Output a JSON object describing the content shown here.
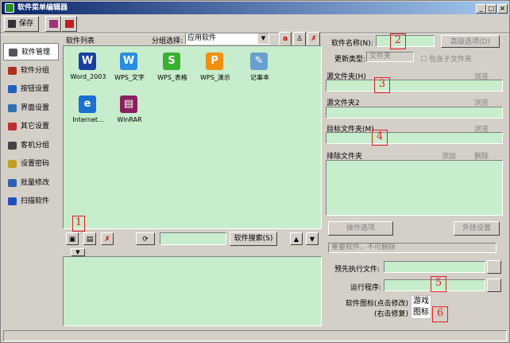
{
  "window": {
    "title": "软件菜单编辑器",
    "min": "_",
    "max": "□",
    "close": "×"
  },
  "toolbar": {
    "save": "保存"
  },
  "nav": [
    {
      "label": "软件管理",
      "color": "#555"
    },
    {
      "label": "软件分组",
      "color": "#b03020"
    },
    {
      "label": "按钮设置",
      "color": "#2060c0"
    },
    {
      "label": "界面设置",
      "color": "#3070b0"
    },
    {
      "label": "其它设置",
      "color": "#c03030"
    },
    {
      "label": "客机分组",
      "color": "#444"
    },
    {
      "label": "设置密码",
      "color": "#c0a020"
    },
    {
      "label": "批量修改",
      "color": "#3060b0"
    },
    {
      "label": "扫描软件",
      "color": "#2050c0"
    }
  ],
  "list": {
    "title": "软件列表",
    "group_label": "分组选择:",
    "group_value": "应用软件",
    "icons": [
      {
        "label": "Word_2003",
        "glyph": "W",
        "color": "#1a3fa0"
      },
      {
        "label": "WPS_文字",
        "glyph": "W",
        "color": "#2a8de0"
      },
      {
        "label": "WPS_表格",
        "glyph": "S",
        "color": "#3ab030"
      },
      {
        "label": "WPS_演示",
        "glyph": "P",
        "color": "#f09010"
      },
      {
        "label": "记事本",
        "glyph": "✎",
        "color": "#6aa0d0"
      },
      {
        "label": "Internet...",
        "glyph": "e",
        "color": "#1a70d0"
      },
      {
        "label": "WinRAR",
        "glyph": "▤",
        "color": "#8a2060"
      }
    ],
    "search_button": "软件搜索(S)"
  },
  "form": {
    "name_label": "软件名称(N):",
    "advanced": "高级选项(D)",
    "type_label": "更新类型:",
    "type_value": "文件夹",
    "include_sub": "包含子文件夹",
    "src_label": "源文件夹(H)",
    "browse": "浏览",
    "src2_label": "源文件夹2",
    "target_label": "目标文件夹(M)",
    "exclude_label": "排除文件夹",
    "add": "添加",
    "delete": "删除",
    "ops": "操作选项",
    "external": "外挂设置",
    "important": "重要软件，不可删除",
    "pre_label": "预先执行文件:",
    "run_label": "运行程序:",
    "icon_label_1": "软件图标(点击修改)",
    "icon_label_2": "(右击修复)",
    "game_icon": "游戏图标"
  },
  "markers": [
    "1",
    "2",
    "3",
    "4",
    "5",
    "6"
  ]
}
